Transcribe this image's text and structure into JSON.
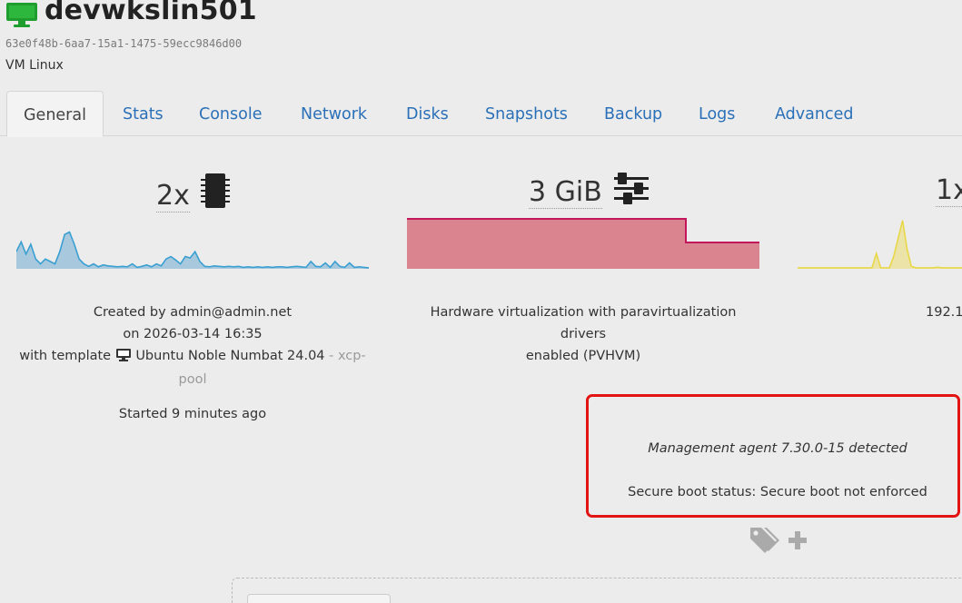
{
  "vm": {
    "name": "devwkslin501",
    "uuid": "63e0f48b-6aa7-15a1-1475-59ecc9846d00",
    "os": "VM Linux",
    "icon": "monitor-icon",
    "status_color": "#1f9d2e"
  },
  "tabs": [
    {
      "label": "General",
      "active": true
    },
    {
      "label": "Stats"
    },
    {
      "label": "Console"
    },
    {
      "label": "Network"
    },
    {
      "label": "Disks"
    },
    {
      "label": "Snapshots"
    },
    {
      "label": "Backup"
    },
    {
      "label": "Logs"
    },
    {
      "label": "Advanced"
    }
  ],
  "stats": {
    "cpu": {
      "value": "2x",
      "icon": "cpu-chip-icon",
      "color": "#3a9fd1",
      "fill": "#a8c8de",
      "series": [
        0.35,
        0.55,
        0.3,
        0.5,
        0.2,
        0.1,
        0.2,
        0.15,
        0.1,
        0.35,
        0.7,
        0.75,
        0.5,
        0.2,
        0.1,
        0.05,
        0.1,
        0.04,
        0.08,
        0.06,
        0.05,
        0.04,
        0.05,
        0.04,
        0.1,
        0.03,
        0.05,
        0.08,
        0.04,
        0.1,
        0.06,
        0.2,
        0.25,
        0.18,
        0.1,
        0.25,
        0.22,
        0.35,
        0.15,
        0.05,
        0.04,
        0.06,
        0.05,
        0.04,
        0.05,
        0.04,
        0.05,
        0.03,
        0.04,
        0.03,
        0.04,
        0.03,
        0.04,
        0.03,
        0.04,
        0.04,
        0.03,
        0.04,
        0.05,
        0.04,
        0.03,
        0.15,
        0.05,
        0.04,
        0.12,
        0.03,
        0.15,
        0.05,
        0.03,
        0.12,
        0.03,
        0.04,
        0.03,
        0.02
      ]
    },
    "memory": {
      "value": "3 GiB",
      "icon": "sliders-icon",
      "color": "#c2185b",
      "fill": "#d9848f"
    },
    "network": {
      "value": "1x",
      "icon": "network-icon",
      "color": "#e8d848",
      "fill": "#ece3a8",
      "series": [
        0.02,
        0.02,
        0.02,
        0.02,
        0.02,
        0.02,
        0.02,
        0.02,
        0.02,
        0.02,
        0.02,
        0.02,
        0.02,
        0.02,
        0.02,
        0.02,
        0.02,
        0.02,
        0.3,
        0.02,
        0.02,
        0.02,
        0.25,
        0.6,
        0.95,
        0.4,
        0.05,
        0.02,
        0.02,
        0.02,
        0.02,
        0.02,
        0.03,
        0.02,
        0.02,
        0.02,
        0.02,
        0.02,
        0.02,
        0.02,
        0.02,
        0.02,
        0.02,
        0.02,
        0.02,
        0.2,
        0.02,
        0.02,
        0.02,
        0.25,
        0.02,
        0.02,
        0.02,
        0.02,
        0.02
      ]
    }
  },
  "info": {
    "created_by": "Created by admin@admin.net",
    "created_on": "on 2026-03-14 16:35",
    "template_prefix": "with template",
    "template_icon": "monitor-icon",
    "template_name": "Ubuntu Noble Numbat 24.04",
    "template_pool_sep": "-",
    "pool_name_part1": "xcp-",
    "pool_name_part2": "pool",
    "started": "Started 9 minutes ago",
    "virtualization_line1": "Hardware virtualization with paravirtualization drivers",
    "virtualization_line2": "enabled (PVHVM)",
    "ip_partial": "192.1"
  },
  "agent": {
    "management_agent": "Management agent 7.30.0-15 detected",
    "secure_boot": "Secure boot status: Secure boot not enforced",
    "highlight_color": "#e31414"
  },
  "tags": {
    "icon": "tags-icon",
    "add_icon": "plus-icon"
  }
}
